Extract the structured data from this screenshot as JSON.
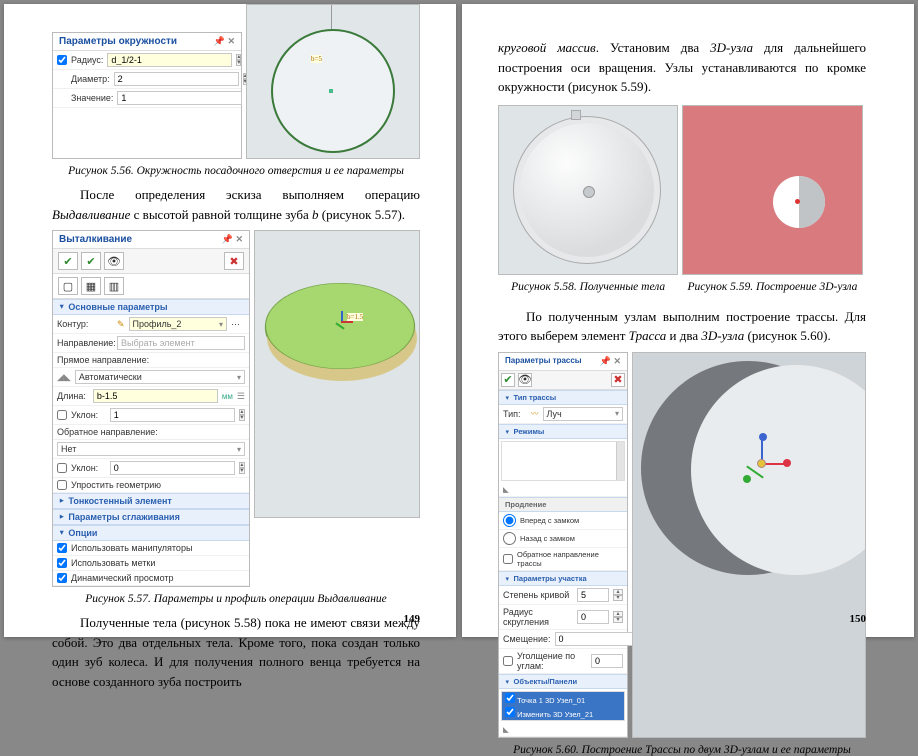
{
  "left": {
    "fig556": {
      "panel_title": "Параметры окружности",
      "radius_label": "Радиус:",
      "radius_value": "d_1/2-1",
      "diameter_label": "Диаметр:",
      "diameter_value": "2",
      "value_label": "Значение:",
      "value_value": "1",
      "caption": "Рисунок 5.56. Окружность посадочного отверстия и ее параметры"
    },
    "para1_1": "После определения эскиза выполняем операцию ",
    "para1_em1": "Выдавливание",
    "para1_2": " с высотой равной толщине зуба ",
    "para1_em2": "b",
    "para1_3": " (рисунок 5.57).",
    "fig557": {
      "title": "Выталкивание",
      "main_params": "Основные параметры",
      "contour_label": "Контур:",
      "contour_value": "Профиль_2",
      "direction_label": "Направление:",
      "direction_value": "Выбрать элемент",
      "fwd_label": "Прямое направление:",
      "auto": "Автоматически",
      "length_label": "Длина:",
      "length_value": "b-1.5",
      "length_unit": "мм",
      "angle1_label": "Уклон:",
      "angle1_value": "1",
      "rev_label": "Обратное направление:",
      "none": "Нет",
      "angle2_label": "Уклон:",
      "angle2_value": "0",
      "simplify": "Упростить геометрию",
      "thinwall": "Тонкостенный элемент",
      "smooth": "Параметры сглаживания",
      "options": "Опции",
      "opt1": "Использовать манипуляторы",
      "opt2": "Использовать метки",
      "opt3": "Динамический просмотр",
      "caption": "Рисунок 5.57. Параметры и профиль операции Выдавливание"
    },
    "para2": "Полученные тела (рисунок 5.58) пока не имеют связи между собой. Это два отдельных тела. Кроме того, пока создан только один зуб колеса. И для получения полного венца требуется на основе созданного зуба построить",
    "page_num": "149"
  },
  "right": {
    "para1_em1": "круговой массив",
    "para1_1": ". Установим два ",
    "para1_em2": "3D-узла",
    "para1_2": " для дальнейшего построения оси вращения. Узлы устанавливаются по кромке окружности (рисунок 5.59).",
    "cap58": "Рисунок 5.58. Полученные тела",
    "cap59": "Рисунок 5.59. Построение 3D-узла",
    "para2_1": "По полученным узлам выполним построение трассы. Для этого выберем элемент ",
    "para2_em1": "Трасса",
    "para2_2": " и два ",
    "para2_em2": "3D-узла",
    "para2_3": " (рисунок 5.60).",
    "fig560": {
      "title": "Параметры трассы",
      "tab1": "Тип трассы",
      "type_label": "Тип:",
      "type_value": "Луч",
      "sec_route": "Режимы",
      "sec_span": "Продление",
      "span1": "Вперед с замком",
      "span2": "Назад с замком",
      "rev": "Обратное направление трассы",
      "sec_params": "Параметры участка",
      "curv_label": "Степень кривой",
      "curv_val": "5",
      "rad_label": "Радиус скругления",
      "rad_val": "0",
      "off_label": "Смещение:",
      "off_val": "0",
      "flat_label": "Уголщение по углам:",
      "flat_val": "0",
      "sec_objs": "Объекты/Панели",
      "obj1": "Точка 1 3D Узел_01",
      "obj2": "Изменить 3D Узел_21",
      "caption": "Рисунок 5.60. Построение Трассы по двум 3D-узлам и ее параметры"
    },
    "page_num": "150"
  }
}
